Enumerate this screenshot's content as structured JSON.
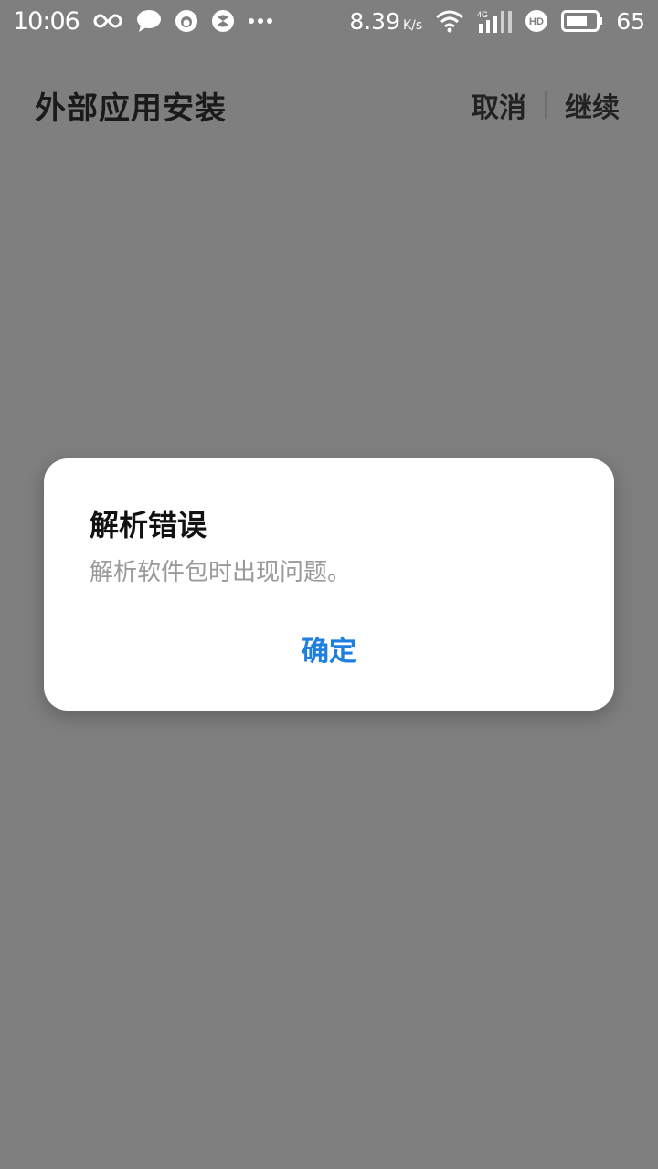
{
  "status_bar": {
    "time": "10:06",
    "net_speed": "8.39",
    "net_speed_unit": "K/s",
    "battery_percent": "65",
    "icons": [
      "infinity-icon",
      "chat-bubble-icon",
      "face-icon",
      "circle-app-icon",
      "more-dots-icon",
      "wifi-icon",
      "signal-4g-icon",
      "hd-icon",
      "battery-icon"
    ]
  },
  "header": {
    "title": "外部应用安装",
    "cancel_label": "取消",
    "continue_label": "继续"
  },
  "dialog": {
    "title": "解析错误",
    "message": "解析软件包时出现问题。",
    "confirm_label": "确定"
  },
  "colors": {
    "background": "#7f7f7f",
    "dialog_background": "#ffffff",
    "accent": "#1f7fe0",
    "message_text": "#9a9a9a"
  }
}
